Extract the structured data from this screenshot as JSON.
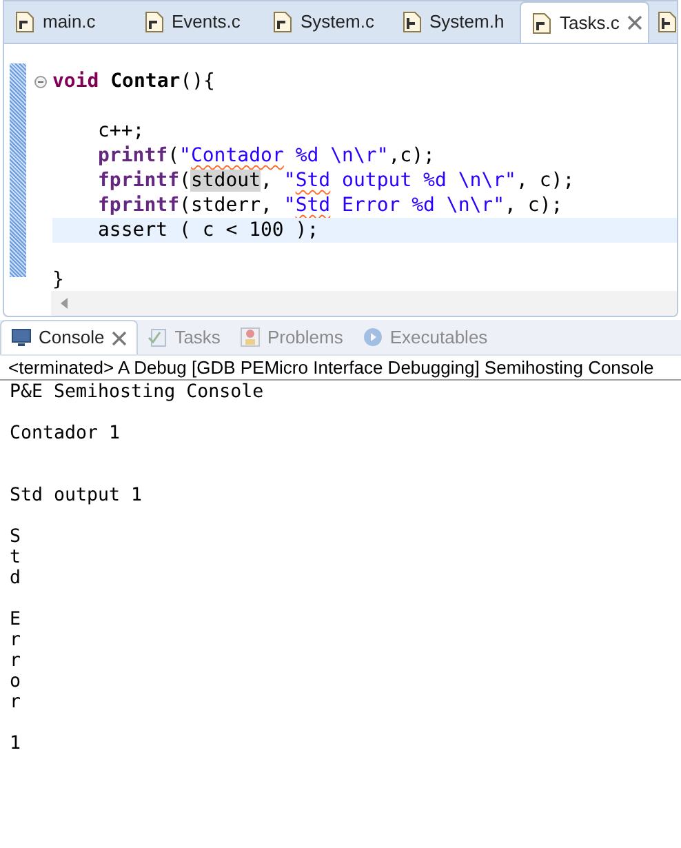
{
  "editor_tabs": [
    {
      "label": "main.c",
      "kind": "c",
      "selected": false
    },
    {
      "label": "Events.c",
      "kind": "c",
      "selected": false
    },
    {
      "label": "System.c",
      "kind": "c",
      "selected": false
    },
    {
      "label": "System.h",
      "kind": "h",
      "selected": false
    },
    {
      "label": "Tasks.c",
      "kind": "c",
      "selected": true
    }
  ],
  "overflow_tab": {
    "kind": "h"
  },
  "code_lines": [
    {
      "kind": "blank"
    },
    {
      "kind": "code",
      "folded": false,
      "current": false,
      "tokens": [
        {
          "kind": "keyword",
          "text": "void"
        },
        {
          "kind": "definition",
          "text": "Contar",
          "space_before": true
        },
        {
          "kind": "plain",
          "text": "(){"
        }
      ]
    },
    {
      "kind": "blank"
    },
    {
      "kind": "code",
      "current": false,
      "indented": true,
      "tokens": [
        {
          "kind": "plain",
          "text": "c++;"
        }
      ]
    },
    {
      "kind": "code",
      "current": false,
      "indented": true,
      "tokens": [
        {
          "kind": "function",
          "text": "printf"
        },
        {
          "kind": "plain",
          "text": "("
        },
        {
          "kind": "string",
          "text": "\""
        },
        {
          "kind": "string",
          "text": "Contador",
          "misspelled": true
        },
        {
          "kind": "string",
          "text": " %d \\n\\r\""
        },
        {
          "kind": "plain",
          "text": ",c);"
        }
      ]
    },
    {
      "kind": "code",
      "current": false,
      "indented": true,
      "tokens": [
        {
          "kind": "function",
          "text": "fprintf"
        },
        {
          "kind": "plain",
          "text": "("
        },
        {
          "kind": "occurrence",
          "text": "stdout"
        },
        {
          "kind": "plain",
          "text": ", "
        },
        {
          "kind": "string",
          "text": "\""
        },
        {
          "kind": "string",
          "text": "Std",
          "misspelled": true
        },
        {
          "kind": "string",
          "text": " output %d \\n\\r\""
        },
        {
          "kind": "plain",
          "text": ", c);"
        }
      ]
    },
    {
      "kind": "code",
      "current": false,
      "indented": true,
      "tokens": [
        {
          "kind": "function",
          "text": "fprintf"
        },
        {
          "kind": "plain",
          "text": "(stderr, "
        },
        {
          "kind": "string",
          "text": "\""
        },
        {
          "kind": "string",
          "text": "Std",
          "misspelled": true
        },
        {
          "kind": "string",
          "text": " Error %d \\n\\r\""
        },
        {
          "kind": "plain",
          "text": ", c);"
        }
      ]
    },
    {
      "kind": "code",
      "current": true,
      "indented": true,
      "tokens": [
        {
          "kind": "plain",
          "text": "assert ( c < 100 );"
        }
      ]
    },
    {
      "kind": "blank"
    },
    {
      "kind": "code",
      "current": false,
      "tokens": [
        {
          "kind": "plain",
          "text": "}"
        }
      ]
    }
  ],
  "view_tabs": [
    {
      "label": "Console",
      "kind": "console",
      "selected": true
    },
    {
      "label": "Tasks",
      "kind": "tasks",
      "selected": false
    },
    {
      "label": "Problems",
      "kind": "problems",
      "selected": false
    },
    {
      "label": "Executables",
      "kind": "executables",
      "selected": false
    }
  ],
  "console_header": "<terminated> A Debug [GDB PEMicro Interface Debugging] Semihosting Console",
  "console_lines": [
    {
      "kind": "text",
      "text": "P&E Semihosting Console"
    },
    {
      "kind": "blank"
    },
    {
      "kind": "text",
      "text": "Contador 1"
    },
    {
      "kind": "blank"
    },
    {
      "kind": "blank"
    },
    {
      "kind": "text",
      "text": "Std output 1"
    },
    {
      "kind": "blank"
    },
    {
      "kind": "text",
      "text": "S"
    },
    {
      "kind": "text",
      "text": "t"
    },
    {
      "kind": "text",
      "text": "d"
    },
    {
      "kind": "blank"
    },
    {
      "kind": "text",
      "text": "E"
    },
    {
      "kind": "text",
      "text": "r"
    },
    {
      "kind": "text",
      "text": "r"
    },
    {
      "kind": "text",
      "text": "o"
    },
    {
      "kind": "text",
      "text": "r"
    },
    {
      "kind": "blank"
    },
    {
      "kind": "text",
      "text": "1"
    }
  ]
}
